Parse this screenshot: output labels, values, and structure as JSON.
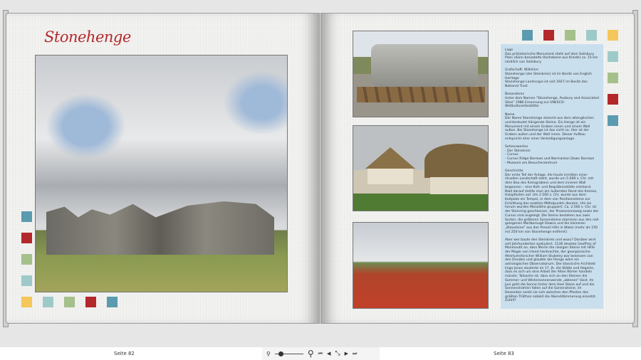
{
  "left_page": {
    "title": "Stonehenge",
    "page_label": "Seite 82"
  },
  "right_page": {
    "page_label": "Seite 83",
    "info_text": [
      "Lage\nDas prähistorische Monument steht auf dem Salisbury Plain (dünn besiedelte Hochebene aus Kreide) ca. 15 km nördlich von Salisbury.",
      "Grafschaft: Wiltshire\nStonehenge (der Steinkreis) ist im Besitz von English Heritage\nStonehenge Landscape ist seit 1927 im Besitz des National Trust",
      "Besonderes\nUnter dem Namen \"Stonehenge, Avebury and Associated Sites\" 1986 Ernennung zur UNESCO-Weltkulturerbestätte.",
      "Name\nDer Name Stonehenge stammt aus dem altenglischen und bedeutet hängende Steine. Ein Henge ist ein Monument mit einem Graben innen und einem Wall außen. Bei Stonehenge ist das nicht so. Hier ist der Graben außen und der Wall innen. Dieser Aufbau entspricht eher einer Verteidigungsanlage.",
      "Sehenswertes\n- Der Steinkreis\n- Cursus\n- Cursus Ridge Barrows und Normanton Down Barrows\n- Museum am Besucherzentrum",
      "Geschichte\nDer erste Teil der Anlage, die heute inmitten einer rituellen Landschaft steht, wurde um 5.000 v. Chr. mit dem Bau des Kreisgrabens und dem inneren Wall begonnen – eine Kult- und Begräbnisstätte entstand. Bald darauf stellte man am äußersten Rand des Kreises, Holzpfosten auf. Um 2.500 v. Chr. wurde aus dem Kultplatz ein Tempel, in dem vier Positionssteine zur Ermittlung des exakten Mittelpunkts dienten. Um sie herum wurden Monolithe gruppiert. Ca. 2.500 v. Chr. ist der Steinring geschlossen, der Prozessionsweg sowie der Cursus sind angelegt. Die Steine bestehen aus zwei Sorten: die größeren Sarsensteine stammen aus den nah gelegenen Marlborough Downs und die kleineren „Blausteine\" aus den Preseli Hills in Wales (mehr als 150 mi/ 250 km von Stonehenge entfernt).",
      "Aber wer baute den Steinkreis und wozu? Darüber wird seit Jahrhunderten spekuliert. 1136 deutete Geoffrey of Monmouth an, dass Merlin die riesigen Steine mit Hilfe der Magie von Irland hierbrachte, der georgianische Altertumsforscher William Stukeley war besessen von den Druiden und glaubte der Henge wäre ein astrologisches Observatorium. Der klassische Architekt Inigo Jones studierte im 17. Jh. die Stätte und folgerte, dass es sich um eine Arbeit der Alten Römer handeln müsste. Tatsache ist, dass sich an den Steinen die Sommer- und Wintersonnenwende „ablesen\" lässt. Im Juni geht die Sonne hinter dem Heel Stone auf und die Sonnenstrahlen fallen auf die Sarsensteine, im Dezember senkt sie sich zwischen den Pfosten des größten Trilithen sobald die Abenddämmerung einsetzt. Zufall?"
    ]
  },
  "colors": {
    "teal": "#5b9bb0",
    "red": "#b3282b",
    "green": "#a6c08c",
    "light_teal": "#9dcac9",
    "yellow": "#f5c75a",
    "text_box": "#c9dfee"
  },
  "toolbar": {
    "zoom_out": "⚲",
    "zoom_in": "⚲",
    "first": "⏮",
    "prev": "◀",
    "fit": "⤡",
    "next": "▶",
    "last": "⏭",
    "zoom_level": 0.15
  }
}
